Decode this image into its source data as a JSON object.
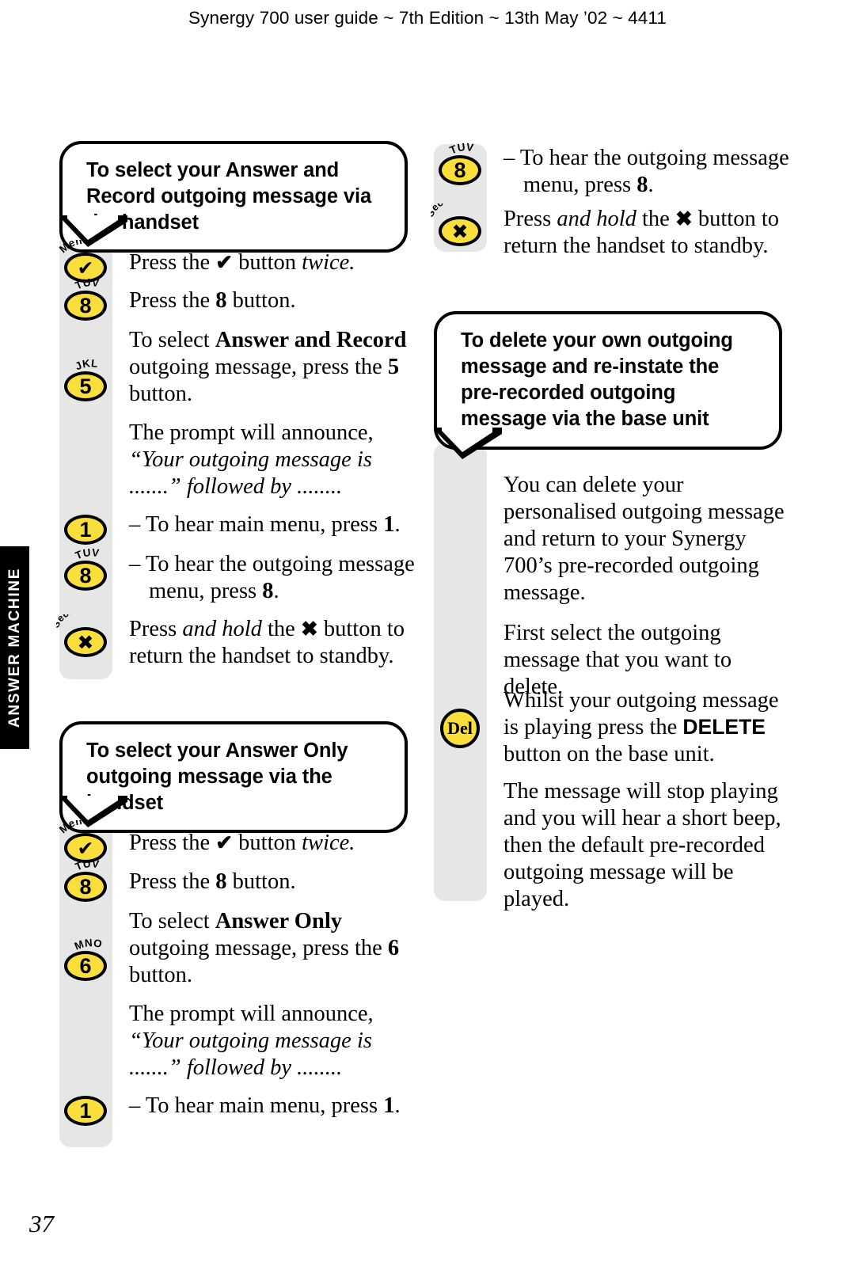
{
  "page": {
    "running_head": "Synergy 700 user guide ~ 7th Edition ~ 13th May ’02 ~ 4411",
    "number": "37",
    "side_tab": "ANSWER MACHINE",
    "colors": {
      "key_yellow": "#FADF3C",
      "rail_grey": "#E6E6E6",
      "tab_black": "#000000"
    }
  },
  "sections": {
    "answer_and_record": {
      "callout": "To select your Answer and Record outgoing message via the handset",
      "steps": [
        {
          "key": "menu-key",
          "key_label": "Menu",
          "key_glyph": "✔",
          "text_html": "Press the <span class=\"chk\">✔</span> button <i>twice.</i>"
        },
        {
          "key": "8-key",
          "key_label": "TUV",
          "key_glyph": "8",
          "text_html": "Press the <b>8</b> button."
        },
        {
          "key": "5-key",
          "key_label": "JKL",
          "key_glyph": "5",
          "text_html": "To select <b>Answer and Record</b> outgoing message, press the <b>5</b> button."
        },
        {
          "key": null,
          "key_label": "",
          "key_glyph": "",
          "text_html": "The prompt will announce, <i>“Your outgoing message is .......”</i> <i>followed by ........</i>"
        },
        {
          "key": "1-key",
          "key_label": "",
          "key_glyph": "1",
          "text_html": "– To hear main menu, press <b>1</b>."
        },
        {
          "key": "8-key",
          "key_label": "TUV",
          "key_glyph": "8",
          "text_html": "– To hear the outgoing message menu, press <b>8</b>."
        },
        {
          "key": "secrecy-key",
          "key_label": "Secrecy",
          "key_glyph": "✖",
          "text_html": "Press <i>and hold</i> the <span class=\"xg\">✖</span> button to return the handset to standby."
        }
      ]
    },
    "answer_only": {
      "callout": "To select your Answer Only outgoing message via the handset",
      "steps": [
        {
          "key": "menu-key",
          "key_label": "Menu",
          "key_glyph": "✔",
          "text_html": "Press the <span class=\"chk\">✔</span> button <i>twice.</i>"
        },
        {
          "key": "8-key",
          "key_label": "TUV",
          "key_glyph": "8",
          "text_html": "Press the <b>8</b> button."
        },
        {
          "key": "6-key",
          "key_label": "MNO",
          "key_glyph": "6",
          "text_html": "To select <b>Answer Only</b> outgoing message, press the <b>6</b> button."
        },
        {
          "key": null,
          "key_label": "",
          "key_glyph": "",
          "text_html": "The prompt will announce, <i>“Your outgoing message is .......”</i> <i>followed by ........</i>"
        },
        {
          "key": "1-key",
          "key_label": "",
          "key_glyph": "1",
          "text_html": "– To hear main menu, press <b>1</b>."
        }
      ]
    },
    "right_top": {
      "steps": [
        {
          "key": "8-key",
          "key_label": "TUV",
          "key_glyph": "8",
          "text_html": "– To hear the outgoing message menu, press <b>8</b>."
        },
        {
          "key": "secrecy-key",
          "key_label": "Secrecy",
          "key_glyph": "✖",
          "text_html": "Press <i>and hold</i> the <span class=\"xg\">✖</span> button to return the handset to standby."
        }
      ]
    },
    "delete_outgoing": {
      "callout": "To delete your own outgoing message and re-instate the pre-recorded outgoing message via the base unit",
      "steps": [
        {
          "key": null,
          "key_label": "",
          "key_glyph": "",
          "text_html": "You can delete your personalised outgoing message and return to your Synergy 700’s pre-recorded outgoing message."
        },
        {
          "key": null,
          "key_label": "",
          "key_glyph": "",
          "text_html": "First select the outgoing message that you want to delete."
        },
        {
          "key": "del-key",
          "key_label": "",
          "key_glyph": "Del",
          "text_html": "Whilst your outgoing message is playing press the <span class=\"sans-b\">DELETE</span> button on the base unit."
        },
        {
          "key": null,
          "key_label": "",
          "key_glyph": "",
          "text_html": "The message will stop playing and you will hear a short beep, then the default pre-recorded outgoing message will be played."
        }
      ]
    }
  }
}
